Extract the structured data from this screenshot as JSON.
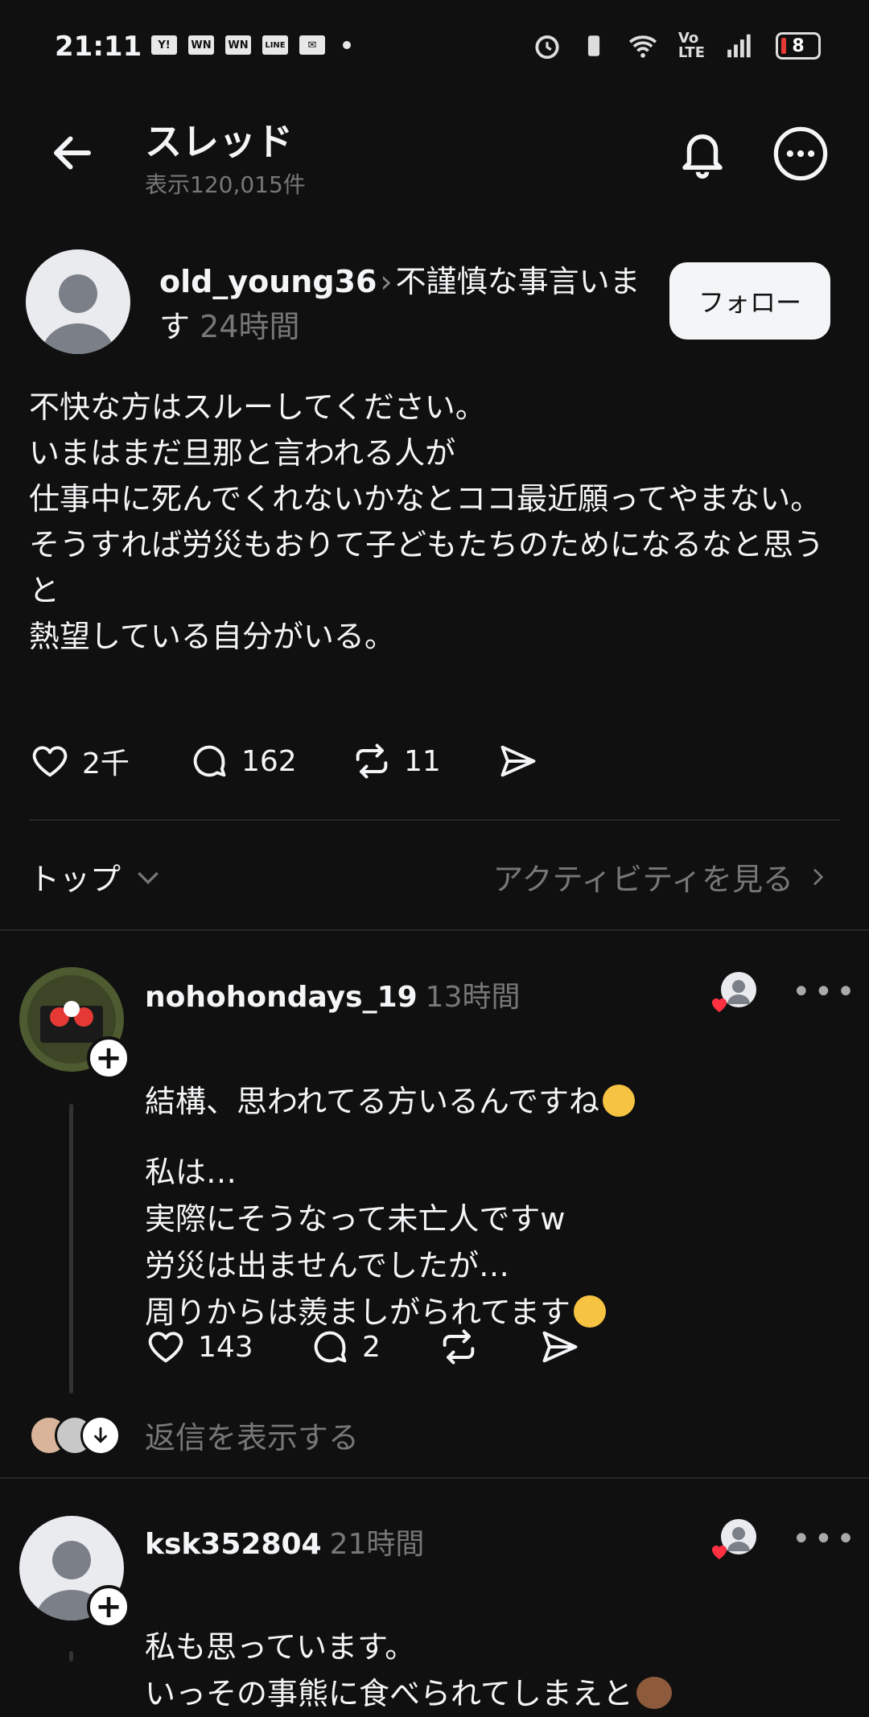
{
  "status_bar": {
    "time": "21:11",
    "notification_icons": [
      "Y!",
      "WN",
      "WN",
      "LINE",
      "mail-icon"
    ],
    "battery": "8"
  },
  "header": {
    "title": "スレッド",
    "views": "表示120,015件"
  },
  "post": {
    "author": "old_young36",
    "topic": "不謹慎な事言います",
    "time": "24時間",
    "follow_label": "フォロー",
    "body": "不快な方はスルーしてください。\nいまはまだ旦那と言われる人が\n仕事中に死んでくれないかなとココ最近願ってやまない。\nそうすれば労災もおりて子どもたちのためになるなと思うと\n熱望している自分がいる。",
    "likes": "2千",
    "replies": "162",
    "reposts": "11"
  },
  "sort": {
    "label": "トップ",
    "activity_link": "アクティビティを見る"
  },
  "comments": [
    {
      "username": "nohohondays_19",
      "time": "13時間",
      "text": "結構、思われてる方いるんですね",
      "reply_text": "私は…\n実際にそうなって未亡人ですw\n労災は出ませんでしたが…\n周りからは羨ましがられてます",
      "likes": "143",
      "replies": "2",
      "show_replies": "返信を表示する"
    },
    {
      "username": "ksk352804",
      "time": "21時間",
      "text": "私も思っています。\nいっその事熊に食べられてしまえと"
    }
  ],
  "colors": {
    "background": "#101010",
    "text": "#f3f5f7",
    "muted": "#777777",
    "like_red": "#ff3040"
  }
}
